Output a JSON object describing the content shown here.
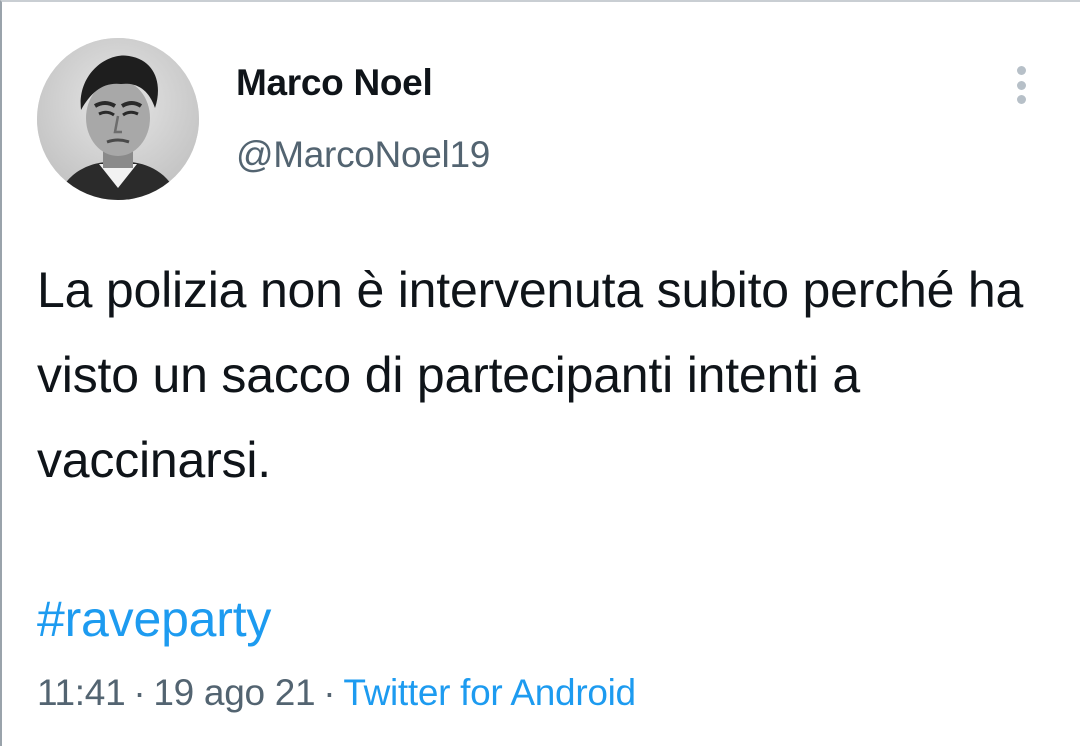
{
  "author": {
    "display_name": "Marco Noel",
    "handle": "@MarcoNoel19",
    "avatar_icon": "person-photo-icon"
  },
  "tweet": {
    "text": "La polizia non è intervenuta subito perché ha visto un sacco di partecipanti intenti a vaccinarsi.",
    "hashtag": "#raveparty"
  },
  "meta": {
    "time": "11:41",
    "date": "19 ago 21",
    "separator": "·",
    "source": "Twitter for Android"
  },
  "colors": {
    "text": "#0f1419",
    "secondary": "#536471",
    "link": "#1d9bf0"
  },
  "icons": {
    "more": "more-vertical-icon"
  }
}
